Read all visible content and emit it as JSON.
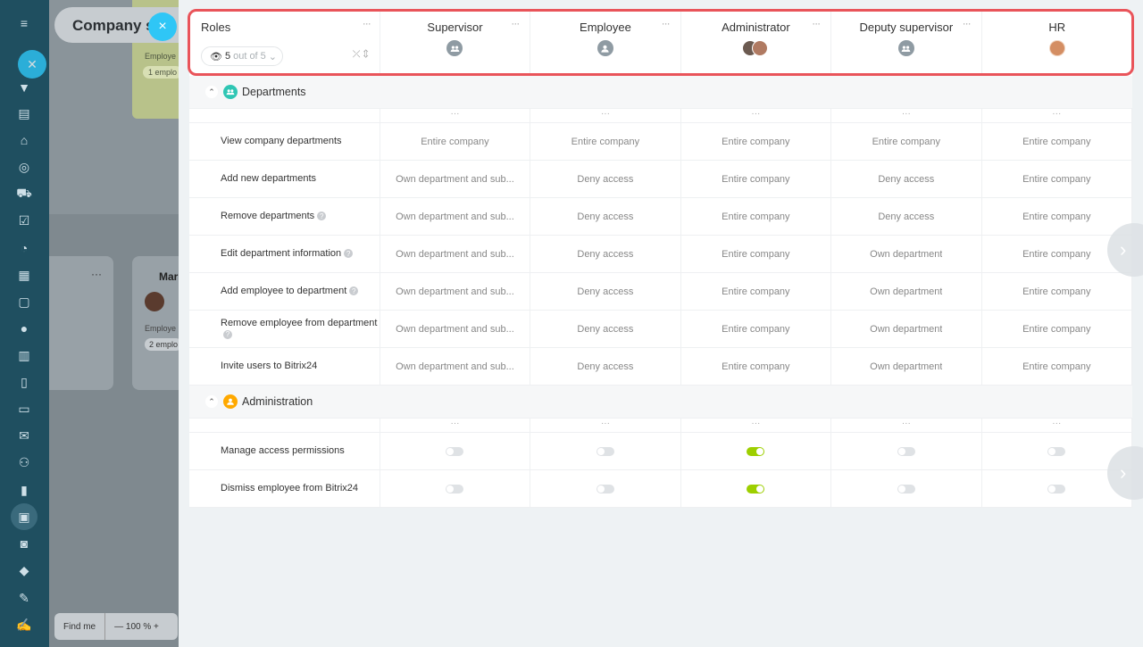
{
  "background": {
    "page_title": "Company s",
    "card_text": "Employe",
    "card_pill": "1 emplo",
    "box_name": "Mar",
    "box_sub": "Employe",
    "box_pill": "2 emplo",
    "find_label": "Find me",
    "zoom_text": "— 100 % +"
  },
  "close_label": "×",
  "roles_header": {
    "label": "Roles",
    "selector_count": "5",
    "selector_suffix": "out of 5"
  },
  "roles": [
    {
      "name": "Supervisor",
      "avatar": "group"
    },
    {
      "name": "Employee",
      "avatar": "user"
    },
    {
      "name": "Administrator",
      "avatar": "duo"
    },
    {
      "name": "Deputy supervisor",
      "avatar": "group"
    },
    {
      "name": "HR",
      "avatar": "photo"
    }
  ],
  "sections": [
    {
      "title": "Departments",
      "icon_color": "#2fc6b4",
      "rows": [
        {
          "label": "View company departments",
          "help": false,
          "values": [
            "Entire company",
            "Entire company",
            "Entire company",
            "Entire company",
            "Entire company"
          ]
        },
        {
          "label": "Add new departments",
          "help": false,
          "values": [
            "Own department and sub...",
            "Deny access",
            "Entire company",
            "Deny access",
            "Entire company"
          ]
        },
        {
          "label": "Remove departments",
          "help": true,
          "values": [
            "Own department and sub...",
            "Deny access",
            "Entire company",
            "Deny access",
            "Entire company"
          ]
        },
        {
          "label": "Edit department information",
          "help": true,
          "values": [
            "Own department and sub...",
            "Deny access",
            "Entire company",
            "Own department",
            "Entire company"
          ]
        },
        {
          "label": "Add employee to department",
          "help": true,
          "values": [
            "Own department and sub...",
            "Deny access",
            "Entire company",
            "Own department",
            "Entire company"
          ]
        },
        {
          "label": "Remove employee from department",
          "help": true,
          "values": [
            "Own department and sub...",
            "Deny access",
            "Entire company",
            "Own department",
            "Entire company"
          ]
        },
        {
          "label": "Invite users to Bitrix24",
          "help": false,
          "values": [
            "Own department and sub...",
            "Deny access",
            "Entire company",
            "Own department",
            "Entire company"
          ]
        }
      ]
    },
    {
      "title": "Administration",
      "icon_color": "#ffa900",
      "rows": [
        {
          "label": "Manage access permissions",
          "help": false,
          "toggles": [
            false,
            false,
            true,
            false,
            false
          ]
        },
        {
          "label": "Dismiss employee from Bitrix24",
          "help": false,
          "toggles": [
            false,
            false,
            true,
            false,
            false
          ]
        }
      ]
    }
  ],
  "colors": {
    "accent_close": "#2fc6f6",
    "toggle_on": "#9dcf00",
    "highlight_outline": "#e9545a",
    "rail": "#1f4f60"
  }
}
